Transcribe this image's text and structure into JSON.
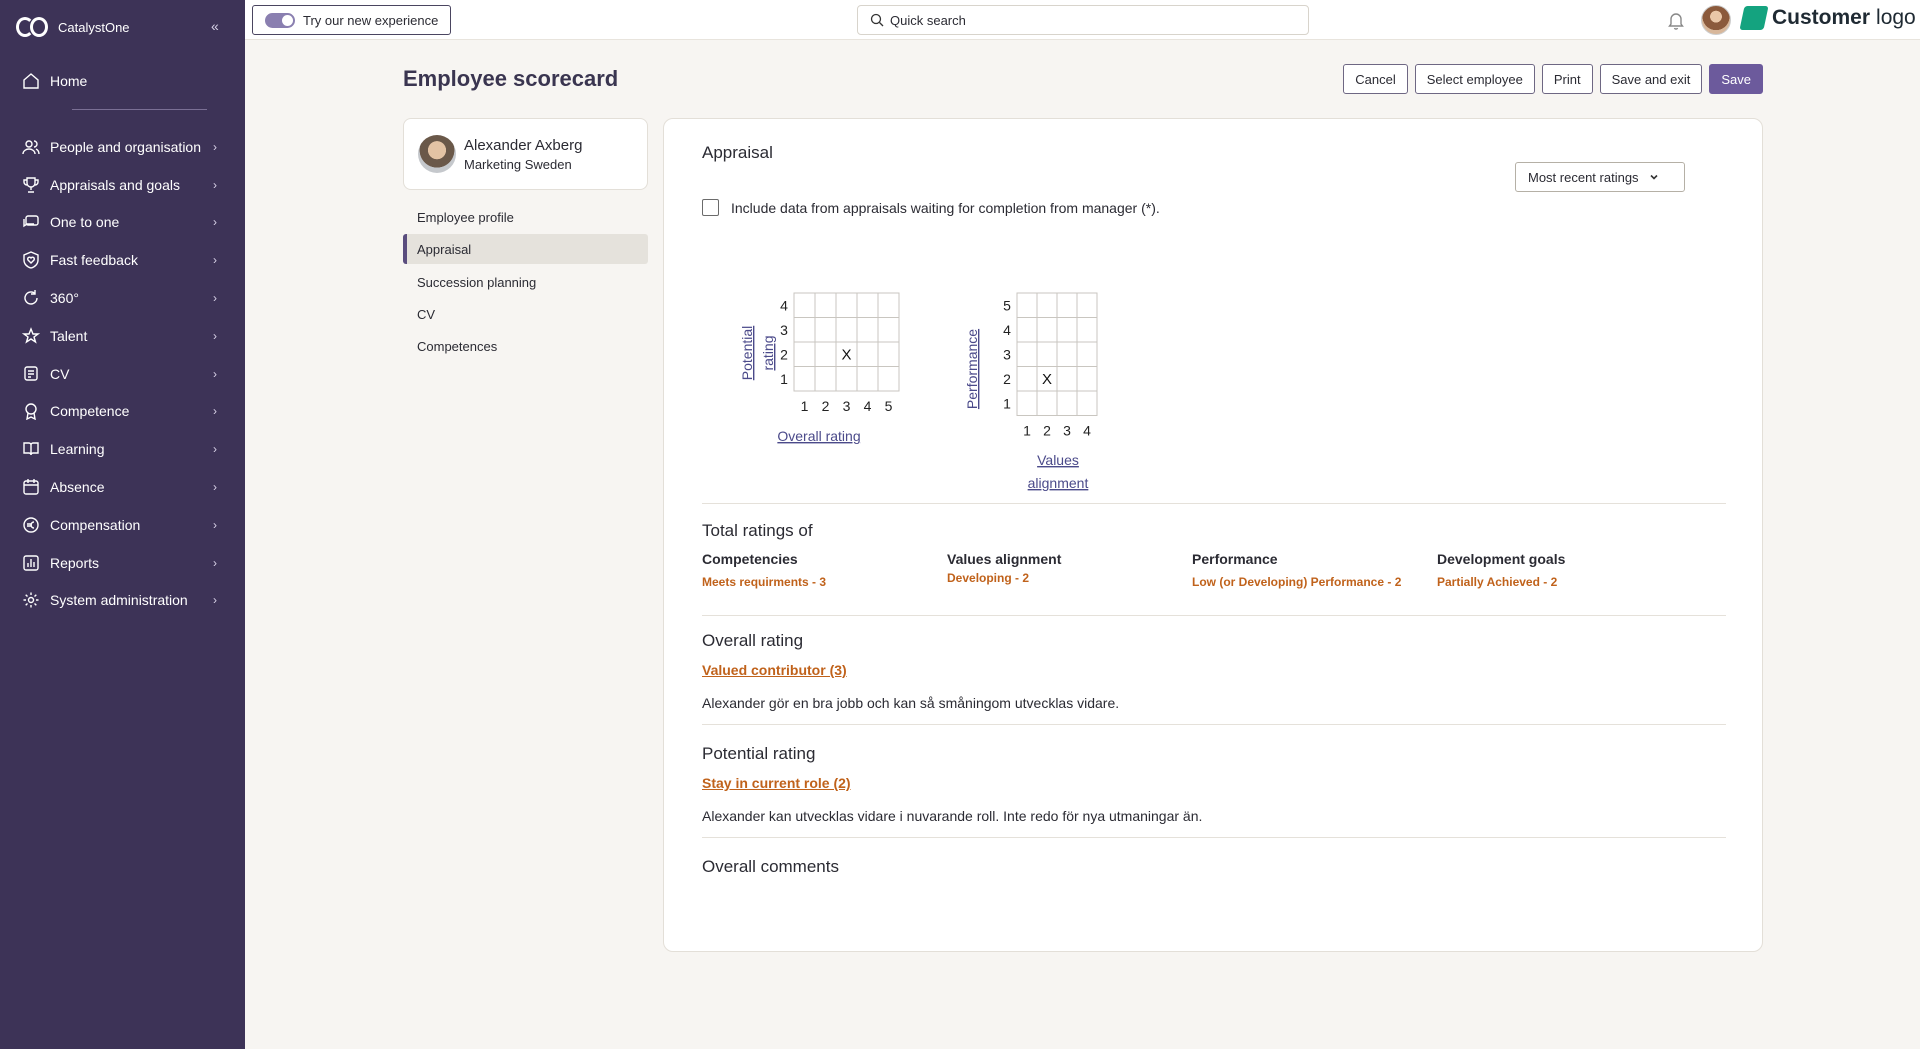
{
  "sidebar": {
    "brand": "CatalystOne",
    "collapse_glyph": "«",
    "home": "Home",
    "items": [
      {
        "label": "People and organisation",
        "icon": "people-icon"
      },
      {
        "label": "Appraisals and goals",
        "icon": "trophy-icon"
      },
      {
        "label": "One to one",
        "icon": "chat-icon"
      },
      {
        "label": "Fast feedback",
        "icon": "heart-shield-icon"
      },
      {
        "label": "360°",
        "icon": "cycle-icon"
      },
      {
        "label": "Talent",
        "icon": "star-icon"
      },
      {
        "label": "CV",
        "icon": "cv-icon"
      },
      {
        "label": "Competence",
        "icon": "badge-icon"
      },
      {
        "label": "Learning",
        "icon": "book-icon"
      },
      {
        "label": "Absence",
        "icon": "calendar-icon"
      },
      {
        "label": "Compensation",
        "icon": "euro-icon"
      },
      {
        "label": "Reports",
        "icon": "chart-icon"
      },
      {
        "label": "System administration",
        "icon": "gear-icon"
      }
    ]
  },
  "topbar": {
    "try_label": "Try our new experience",
    "search_placeholder": "Quick search",
    "customer_logo_bold": "Customer",
    "customer_logo_light": "logo"
  },
  "header": {
    "title": "Employee scorecard",
    "buttons": {
      "cancel": "Cancel",
      "select_employee": "Select employee",
      "print": "Print",
      "save_exit": "Save and exit",
      "save": "Save"
    }
  },
  "employee": {
    "name": "Alexander Axberg",
    "department": "Marketing Sweden"
  },
  "subnav": [
    "Employee profile",
    "Appraisal",
    "Succession planning",
    "CV",
    "Competences"
  ],
  "appraisal": {
    "title": "Appraisal",
    "dropdown": "Most recent ratings",
    "include_label": "Include data from appraisals waiting for completion from manager (*).",
    "grid1": {
      "y_label_1": "Potential",
      "y_label_2": "rating",
      "x_label": "Overall rating",
      "y_ticks": [
        "4",
        "3",
        "2",
        "1"
      ],
      "x_ticks": [
        "1",
        "2",
        "3",
        "4",
        "5"
      ],
      "marker": "X",
      "marked_x": 3,
      "marked_y": 2
    },
    "grid2": {
      "y_label": "Performance",
      "x_label_1": "Values",
      "x_label_2": "alignment",
      "y_ticks": [
        "5",
        "4",
        "3",
        "2",
        "1"
      ],
      "x_ticks": [
        "1",
        "2",
        "3",
        "4"
      ],
      "marker": "X",
      "marked_x": 2,
      "marked_y": 2
    },
    "totals_title": "Total ratings of",
    "totals": [
      {
        "heading": "Competencies",
        "value": "Meets requirments - 3"
      },
      {
        "heading": "Values alignment",
        "value": "Developing - 2"
      },
      {
        "heading": "Performance",
        "value": "Low (or Developing) Performance - 2"
      },
      {
        "heading": "Development goals",
        "value": "Partially Achieved - 2"
      }
    ],
    "overall_title": "Overall rating",
    "overall_link": "Valued contributor (3)",
    "overall_text": "Alexander gör en bra jobb och kan så småningom utvecklas vidare.",
    "potential_title": "Potential rating",
    "potential_link": "Stay in current role (2)",
    "potential_text": "Alexander kan utvecklas vidare i nuvarande roll. Inte redo för nya utmaningar än.",
    "comments_title": "Overall comments"
  }
}
